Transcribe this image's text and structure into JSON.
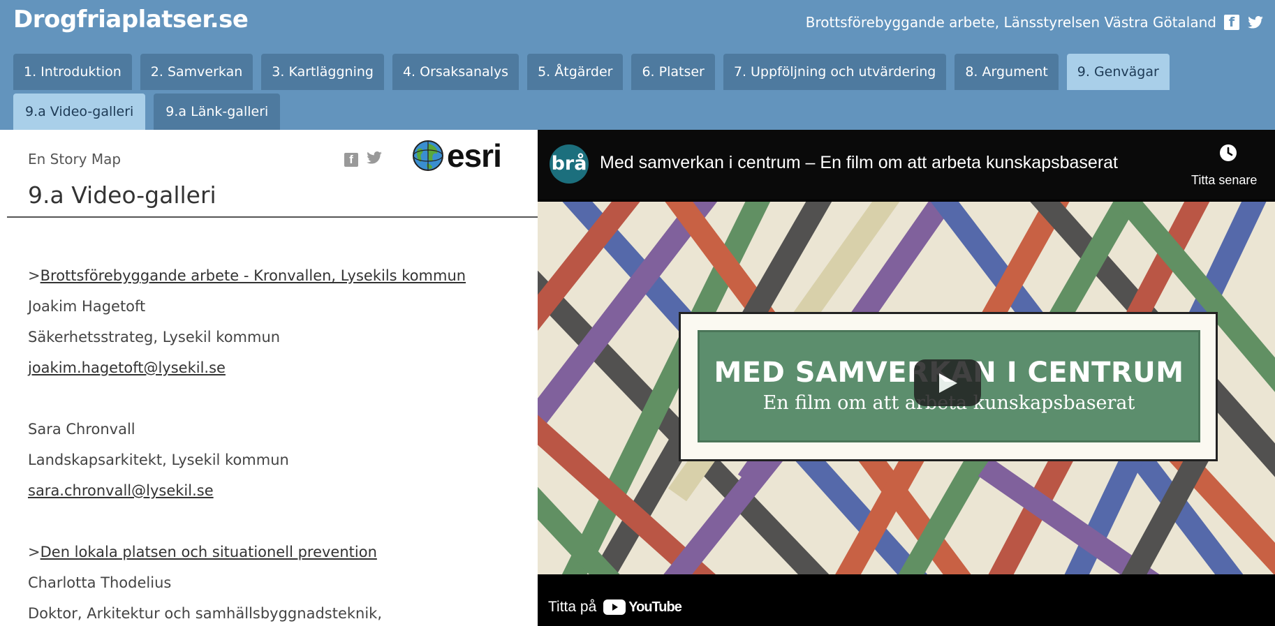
{
  "header": {
    "site_title": "Drogfriaplatser.se",
    "right_text": "Brottsförebyggande arbete, Länsstyrelsen Västra Götaland",
    "icons": [
      "facebook-icon",
      "twitter-icon"
    ]
  },
  "tabs": [
    {
      "label": "1. Introduktion"
    },
    {
      "label": "2. Samverkan"
    },
    {
      "label": "3. Kartläggning"
    },
    {
      "label": "4. Orsaksanalys"
    },
    {
      "label": "5. Åtgärder"
    },
    {
      "label": "6. Platser"
    },
    {
      "label": "7. Uppföljning och utvärdering"
    },
    {
      "label": "8. Argument"
    },
    {
      "label": "9. Genvägar",
      "active": true
    }
  ],
  "subtabs": [
    {
      "label": "9.a Video-galleri",
      "active": true
    },
    {
      "label": "9.a Länk-galleri"
    }
  ],
  "panel": {
    "storymap_label": "En Story Map",
    "title": "9.a Video-galleri",
    "logo_text": "esri",
    "entries": [
      {
        "link_prefix": ">",
        "link": "Brottsförebyggande arbete - Kronvallen, Lysekils kommun",
        "people": [
          {
            "name": "Joakim Hagetoft",
            "role": "Säkerhetsstrateg, Lysekil kommun",
            "email": "joakim.hagetoft@lysekil.se"
          },
          {
            "name": "Sara Chronvall",
            "role": "Landskapsarkitekt, Lysekil kommun",
            "email": "sara.chronvall@lysekil.se"
          }
        ]
      },
      {
        "link_prefix": ">",
        "link": "Den lokala platsen och situationell prevention",
        "people": [
          {
            "name": "Charlotta Thodelius",
            "role": "Doktor, Arkitektur och samhällsbyggnadsteknik,"
          }
        ]
      }
    ]
  },
  "video": {
    "channel_logo": "brå",
    "title": "Med samverkan i centrum – En film om att arbeta kunskapsbaserat",
    "watch_later": "Titta senare",
    "thumb_title": "MED SAMVERKAN I CENTRUM",
    "thumb_subtitle": "En film om att arbeta kunskapsbaserat",
    "watch_on": "Titta på",
    "youtube": "YouTube"
  }
}
